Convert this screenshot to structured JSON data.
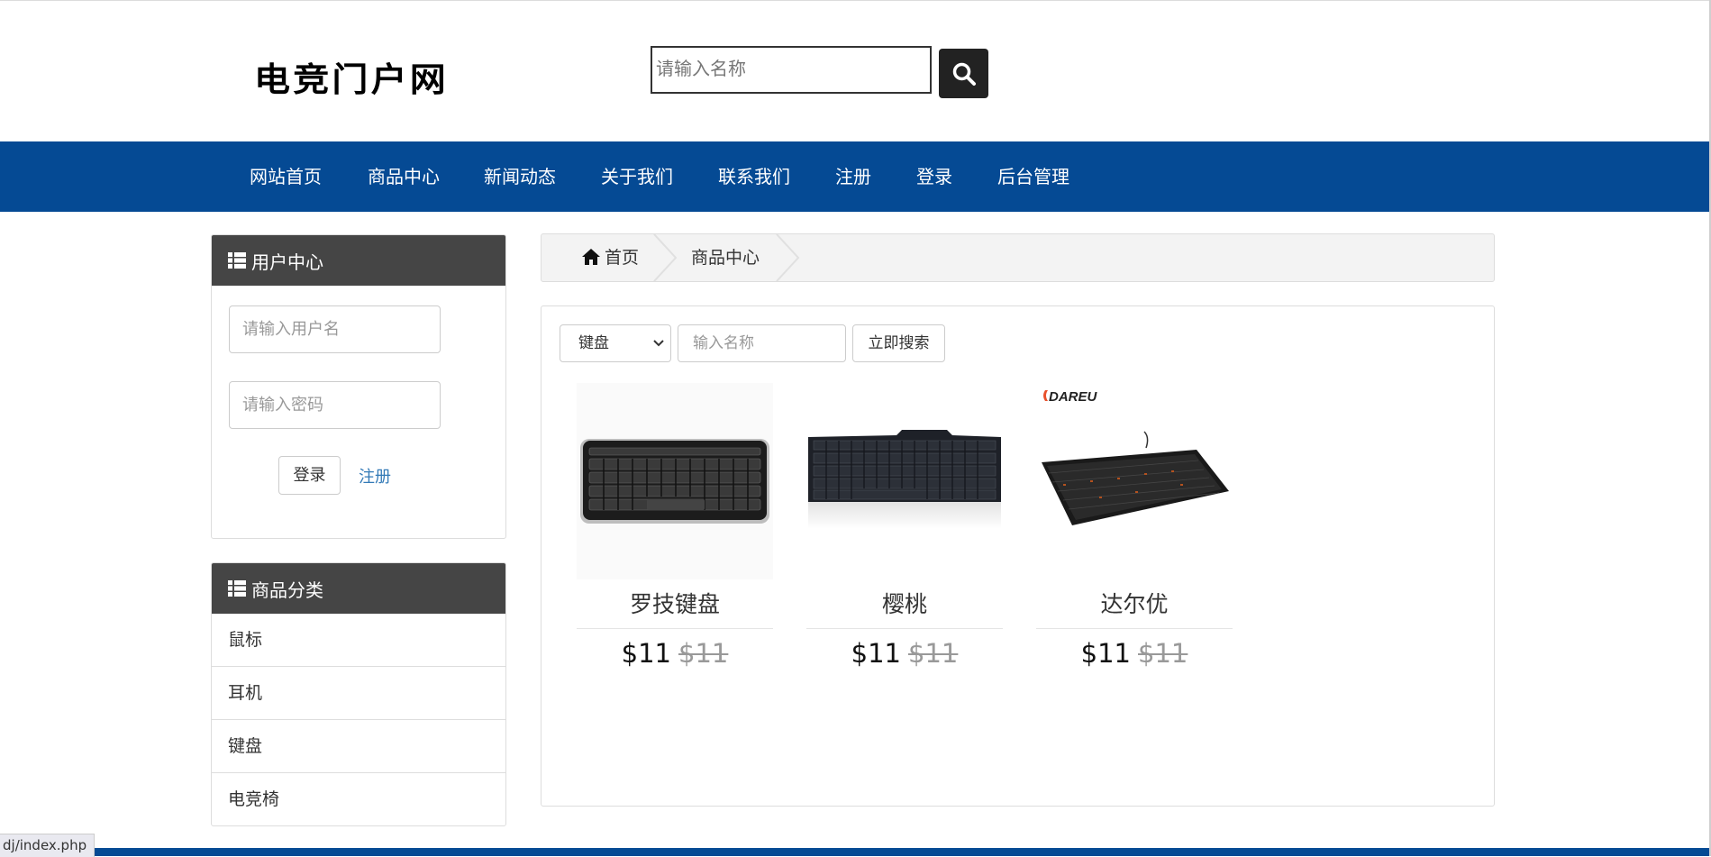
{
  "header": {
    "logo_text": "电竞门户网",
    "search_placeholder": "请输入名称"
  },
  "nav": {
    "items": [
      "网站首页",
      "商品中心",
      "新闻动态",
      "关于我们",
      "联系我们",
      "注册",
      "登录",
      "后台管理"
    ]
  },
  "user_center": {
    "title": "用户中心",
    "username_placeholder": "请输入用户名",
    "password_placeholder": "请输入密码",
    "login_label": "登录",
    "register_label": "注册"
  },
  "categories": {
    "title": "商品分类",
    "items": [
      "鼠标",
      "耳机",
      "键盘",
      "电竞椅"
    ]
  },
  "breadcrumb": {
    "home": "首页",
    "current": "商品中心"
  },
  "filter": {
    "selected_category": "键盘",
    "name_placeholder": "输入名称",
    "search_label": "立即搜索"
  },
  "products": [
    {
      "name": "罗技键盘",
      "price": "$11",
      "old_price": "$11"
    },
    {
      "name": "樱桃",
      "price": "$11",
      "old_price": "$11"
    },
    {
      "name": "达尔优",
      "price": "$11",
      "old_price": "$11",
      "brand_logo": "DAREU"
    }
  ],
  "status_bar": {
    "url": "dj/index.php"
  },
  "colors": {
    "nav_bg": "#054a94",
    "panel_head_bg": "#454545",
    "link": "#337ab7"
  }
}
